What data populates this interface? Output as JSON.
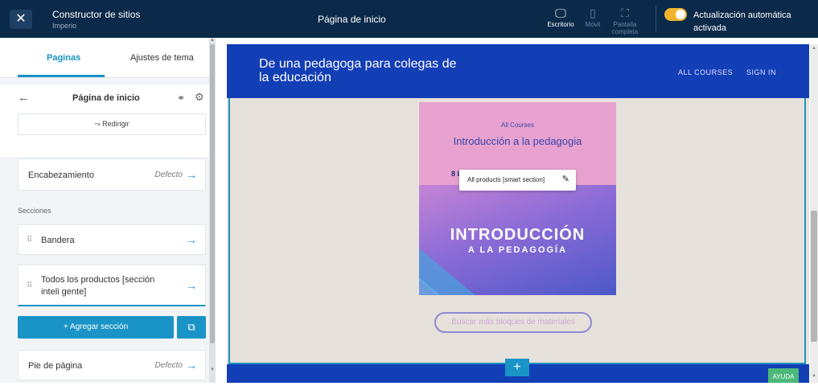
{
  "topbar": {
    "close_icon": "close-icon",
    "app_title": "Constructor de sitios",
    "app_subtitle": "Imperio",
    "page_name": "Página de inicio",
    "devices": [
      {
        "label": "Escritorio",
        "icon": "desktop-icon",
        "active": true
      },
      {
        "label": "Móvil",
        "icon": "mobile-icon",
        "active": false
      },
      {
        "label": "Pantalla completa",
        "icon": "fullscreen-icon",
        "active": false
      }
    ],
    "auto_update_label": "Actualización automática activada",
    "auto_update_on": true,
    "toggle_color": "#f1b42f"
  },
  "sidebar": {
    "tabs": [
      {
        "label": "Paginas",
        "active": true
      },
      {
        "label": "Ajustes de tema",
        "active": false
      }
    ],
    "panel_title": "Página de inicio",
    "redirect_label": "Redirigir",
    "header_section": {
      "label": "Encabezamiento",
      "default": "Defecto"
    },
    "sections_label": "Secciones",
    "sections": [
      {
        "label": "Bandera"
      },
      {
        "label": "Todos los productos [sección inteli gente]"
      }
    ],
    "add_section_label": "+ Agregar sección",
    "footer_section": {
      "label": "Pie de página",
      "default": "Defecto"
    },
    "accent_color": "#1a93c6"
  },
  "preview": {
    "site_title": "De una pedagoga para colegas de la educación",
    "nav": [
      "ALL COURSES",
      "SIGN IN"
    ],
    "course": {
      "category": "All Courses",
      "title": "Introducción a la pedagogia",
      "count_partial": "8 L",
      "image_title": "INTRODUCCIÓN",
      "image_subtitle": "A LA PEDAGOGÍA"
    },
    "smart_section_tooltip": "All products [smart section]",
    "more_blocks_label": "Buscar más bloques de materiales",
    "add_block_label": "+",
    "help_label": "AYUDA",
    "header_color": "#123eb6"
  }
}
